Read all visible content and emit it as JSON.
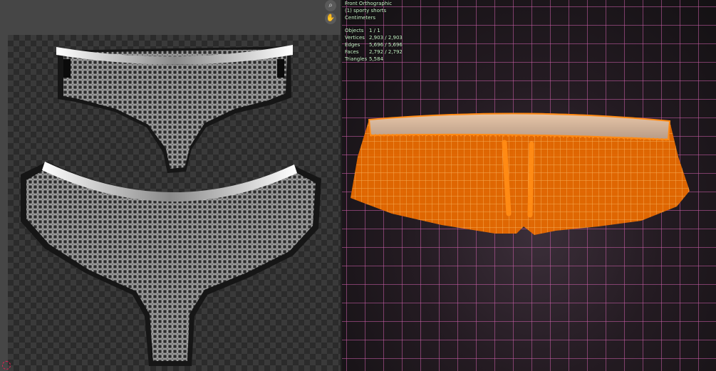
{
  "viewport": {
    "view_name": "Front Orthographic",
    "object_name": "(1) sporty shorts",
    "units": "Centimeters",
    "stats": [
      {
        "label": "Objects",
        "value": "1 / 1"
      },
      {
        "label": "Vertices",
        "value": "2,903 / 2,903"
      },
      {
        "label": "Edges",
        "value": "5,696 / 5,696"
      },
      {
        "label": "Faces",
        "value": "2,792 / 2,792"
      },
      {
        "label": "Triangles",
        "value": "5,584"
      }
    ]
  },
  "uv_editor": {
    "icons": [
      "zoom-icon",
      "hand-icon"
    ]
  },
  "colors": {
    "mesh_orange": "#ff8a14",
    "grid_pink": "#cd5faa",
    "stats_text": "#c8f5c8"
  }
}
